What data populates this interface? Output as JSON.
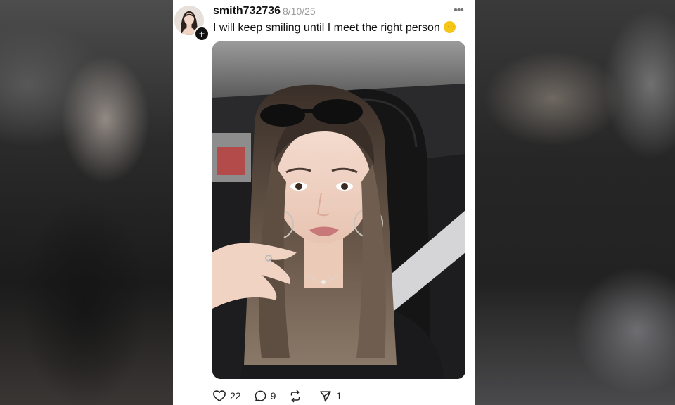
{
  "post": {
    "username": "smith732736",
    "date": "8/10/25",
    "caption": "I will keep smiling until I meet the right person",
    "caption_emoji": "relieved-face-emoji",
    "more_icon": "more-horizontal-icon",
    "follow_icon": "plus-icon"
  },
  "actions": {
    "likes": "22",
    "comments": "9",
    "reposts": "",
    "shares": "1"
  },
  "colors": {
    "card_background": "#ffffff",
    "text_primary": "#111111",
    "text_muted": "#9a9a9a"
  }
}
